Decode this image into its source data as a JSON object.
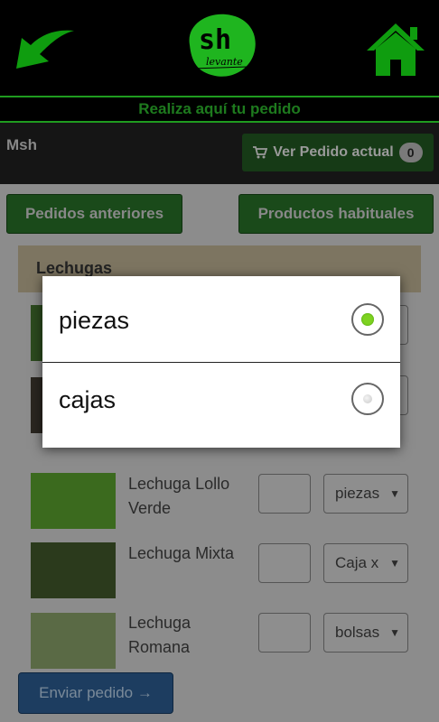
{
  "header": {
    "logo_text": "sh",
    "logo_subtext": "levante",
    "subtitle": "Realiza aquí tu pedido",
    "icons": [
      "back-arrow-icon",
      "home-icon"
    ],
    "colors": {
      "accent": "#0f9d0f",
      "bar_text": "#1e7a1e"
    }
  },
  "topbar": {
    "user": "Msh",
    "order_button_label": "Ver Pedido actual",
    "order_count": "0"
  },
  "nav": {
    "previous_orders": "Pedidos anteriores",
    "usual_products": "Productos habituales"
  },
  "category": {
    "title": "Lechugas"
  },
  "products": [
    {
      "name": "Lechuga Lollo Verde",
      "quantity": "",
      "unit": "piezas"
    },
    {
      "name": "Lechuga Mixta",
      "quantity": "",
      "unit": "Caja x"
    },
    {
      "name": "Lechuga Romana",
      "quantity": "",
      "unit": "bolsas"
    }
  ],
  "send_button": "Enviar pedido →",
  "modal": {
    "options": [
      {
        "label": "piezas",
        "selected": true
      },
      {
        "label": "cajas",
        "selected": false
      }
    ],
    "selected_color": "#7ed321"
  }
}
